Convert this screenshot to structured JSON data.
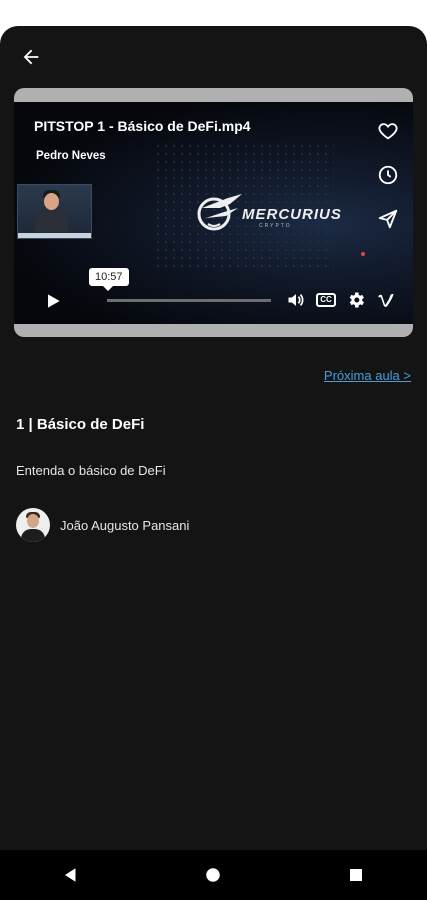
{
  "header": {
    "back_icon": "arrow-left-icon"
  },
  "video": {
    "title": "PITSTOP 1 - Básico de DeFi.mp4",
    "author": "Pedro Neves",
    "logo_text": "MERCURIUS",
    "logo_sub": "CRYPTO",
    "time_tooltip": "10:57",
    "progress": 0.0,
    "side_icons": [
      "heart-icon",
      "clock-icon",
      "send-icon"
    ],
    "control_icons": [
      "volume-icon",
      "cc-icon",
      "settings-icon",
      "vimeo-icon"
    ],
    "cc_label": "CC",
    "vimeo_label": "V"
  },
  "next_lesson": {
    "label": "Próxima aula >"
  },
  "lesson": {
    "title": "1 | Básico de DeFi",
    "description": "Entenda o básico de DeFi",
    "instructor": "João Augusto Pansani"
  },
  "android_nav": [
    "back-triangle-icon",
    "home-circle-icon",
    "recents-square-icon"
  ],
  "colors": {
    "background": "#141414",
    "link": "#4a9cd6",
    "navbar": "#000000"
  }
}
